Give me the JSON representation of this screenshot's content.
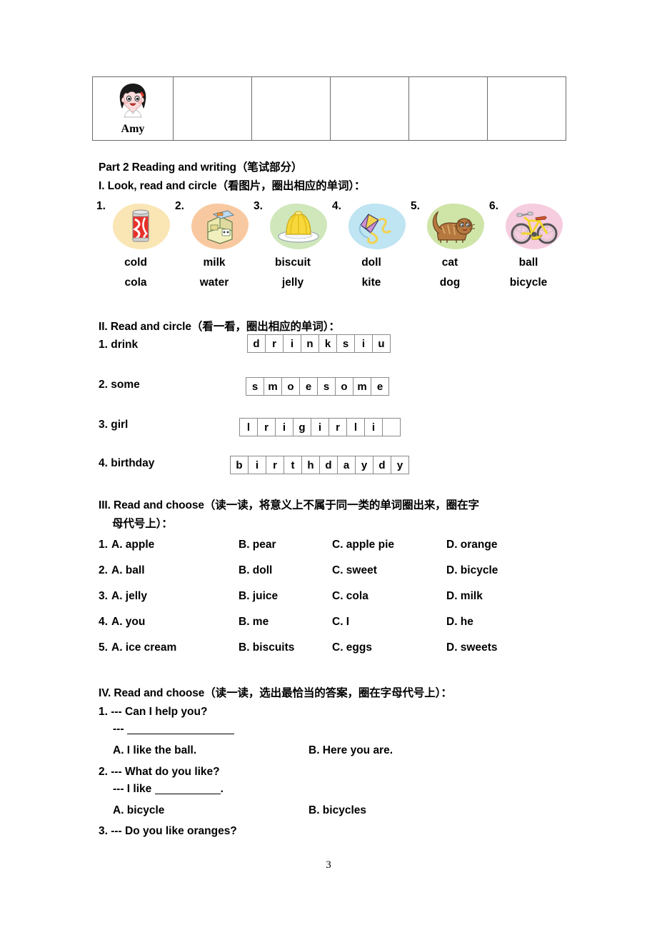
{
  "table": {
    "cells": [
      {
        "name": "Amy",
        "has_image": true,
        "image": "girl-face-amy"
      },
      {
        "name": "",
        "has_image": false
      },
      {
        "name": "",
        "has_image": false
      },
      {
        "name": "",
        "has_image": false
      },
      {
        "name": "",
        "has_image": false
      },
      {
        "name": "",
        "has_image": false
      }
    ]
  },
  "part2": {
    "title_en": "Part 2 Reading and writing",
    "title_cn": "（笔试部分）"
  },
  "section1": {
    "heading_en": "I. Look, read and circle",
    "heading_cn": "（看图片，圈出相应的单词）：",
    "items": [
      {
        "num": "1.",
        "image": "cola-can",
        "blob_color": "#fae6b4",
        "options": [
          "cold",
          "cola"
        ]
      },
      {
        "num": "2.",
        "image": "milk-carton",
        "blob_color": "#f8c9a0",
        "options": [
          "milk",
          "water"
        ]
      },
      {
        "num": "3.",
        "image": "jelly-on-plate",
        "blob_color": "#cfe7bb",
        "options": [
          "biscuit",
          "jelly"
        ]
      },
      {
        "num": "4.",
        "image": "kite",
        "blob_color": "#bfe4f2",
        "options": [
          "doll",
          "kite"
        ]
      },
      {
        "num": "5.",
        "image": "cat",
        "blob_color": "#cfe5a8",
        "options": [
          "cat",
          "dog"
        ]
      },
      {
        "num": "6.",
        "image": "bicycle",
        "blob_color": "#f6ccdf",
        "options": [
          "ball",
          "bicycle"
        ]
      }
    ]
  },
  "section2": {
    "heading_en": "II. Read and circle",
    "heading_cn": "（看一看，圈出相应的单词）：",
    "items": [
      {
        "num": "1.",
        "word": "drink",
        "letters": [
          "d",
          "r",
          "i",
          "n",
          "k",
          "s",
          "i",
          "u"
        ]
      },
      {
        "num": "2.",
        "word": "some",
        "letters": [
          "s",
          "m",
          "o",
          "e",
          "s",
          "o",
          "m",
          "e"
        ]
      },
      {
        "num": "3.",
        "word": "girl",
        "letters": [
          "l",
          "r",
          "i",
          "g",
          "i",
          "r",
          "l",
          "i",
          ""
        ]
      },
      {
        "num": "4.",
        "word": "birthday",
        "letters": [
          "b",
          "i",
          "r",
          "t",
          "h",
          "d",
          "a",
          "y",
          "d",
          "y"
        ]
      }
    ]
  },
  "section3": {
    "heading_en": "III. Read and choose",
    "heading_cn_line1": "（读一读，将意义上不属于同一类的单词圈出来，圈在字",
    "heading_cn_line2": "母代号上）：",
    "items": [
      {
        "num": "1.",
        "a": "A. apple",
        "b": "B. pear",
        "c": "C. apple pie",
        "d": "D. orange"
      },
      {
        "num": "2.",
        "a": "A. ball",
        "b": "B. doll",
        "c": "C. sweet",
        "d": "D. bicycle"
      },
      {
        "num": "3.",
        "a": "A. jelly",
        "b": "B. juice",
        "c": "C. cola",
        "d": "D. milk"
      },
      {
        "num": "4.",
        "a": "A. you",
        "b": "B. me",
        "c": "C. I",
        "d": "D. he"
      },
      {
        "num": "5.",
        "a": "A. ice cream",
        "b": "B. biscuits",
        "c": "C. eggs",
        "d": "D. sweets"
      }
    ]
  },
  "section4": {
    "heading_en": "IV. Read and choose",
    "heading_cn": "（读一读，选出最恰当的答案，圈在字母代号上）：",
    "q1": {
      "prompt": "1. --- Can I help you?",
      "answer_prefix": "---",
      "option_a": "A. I like the ball.",
      "option_b": "B. Here you are."
    },
    "q2": {
      "prompt": "2. --- What do you like?",
      "answer_prefix": "--- I like",
      "answer_suffix": ".",
      "option_a": "A. bicycle",
      "option_b": "B. bicycles"
    },
    "q3": {
      "prompt": "3. --- Do you like oranges?"
    }
  },
  "footer": {
    "page_number": "3"
  }
}
